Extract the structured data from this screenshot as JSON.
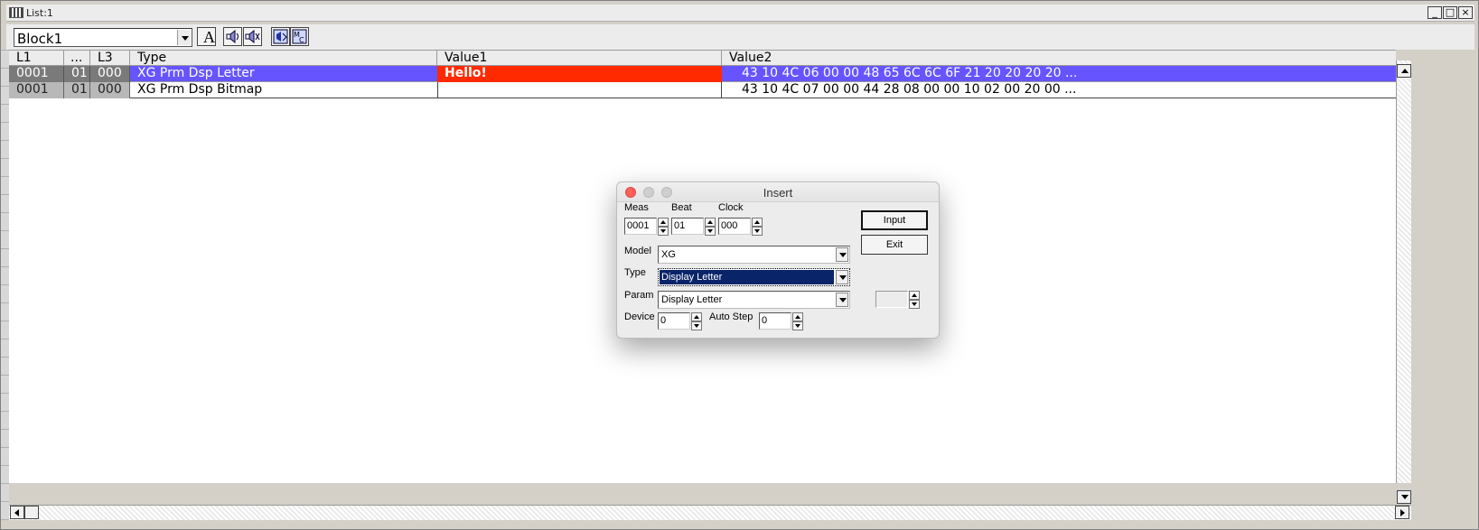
{
  "window": {
    "title": "List:1",
    "min": "_",
    "max": "□",
    "close": "×"
  },
  "toolbar": {
    "block_value": "Block1",
    "font_button": "A"
  },
  "list": {
    "columns": [
      "L1",
      "...",
      "L3",
      "Type",
      "Value1",
      "Value2"
    ],
    "rows": [
      {
        "l1": "0001",
        "dots": "01",
        "l3": "000",
        "type": "XG Prm Dsp Letter",
        "value1": "Hello!",
        "value2": "43 10 4C 06 00 00 48 65 6C 6C 6F 21 20 20 20 20 ...",
        "selected": true
      },
      {
        "l1": "0001",
        "dots": "01",
        "l3": "000",
        "type": "XG Prm Dsp Bitmap",
        "value1": "",
        "value2": "43 10 4C 07 00 00 44 28 08 00 00 10 02 00 20 00 ...",
        "selected": false
      }
    ]
  },
  "dialog": {
    "title": "Insert",
    "meas_label": "Meas",
    "beat_label": "Beat",
    "clock_label": "Clock",
    "meas_value": "0001",
    "beat_value": "01",
    "clock_value": "000",
    "model_label": "Model",
    "model_value": "XG",
    "type_label": "Type",
    "type_value": "Display Letter",
    "param_label": "Param",
    "param_value": "Display Letter",
    "device_label": "Device",
    "device_value": "0",
    "autostep_label": "Auto Step",
    "autostep_value": "0",
    "input_button": "Input",
    "exit_button": "Exit",
    "extra_value": ""
  }
}
